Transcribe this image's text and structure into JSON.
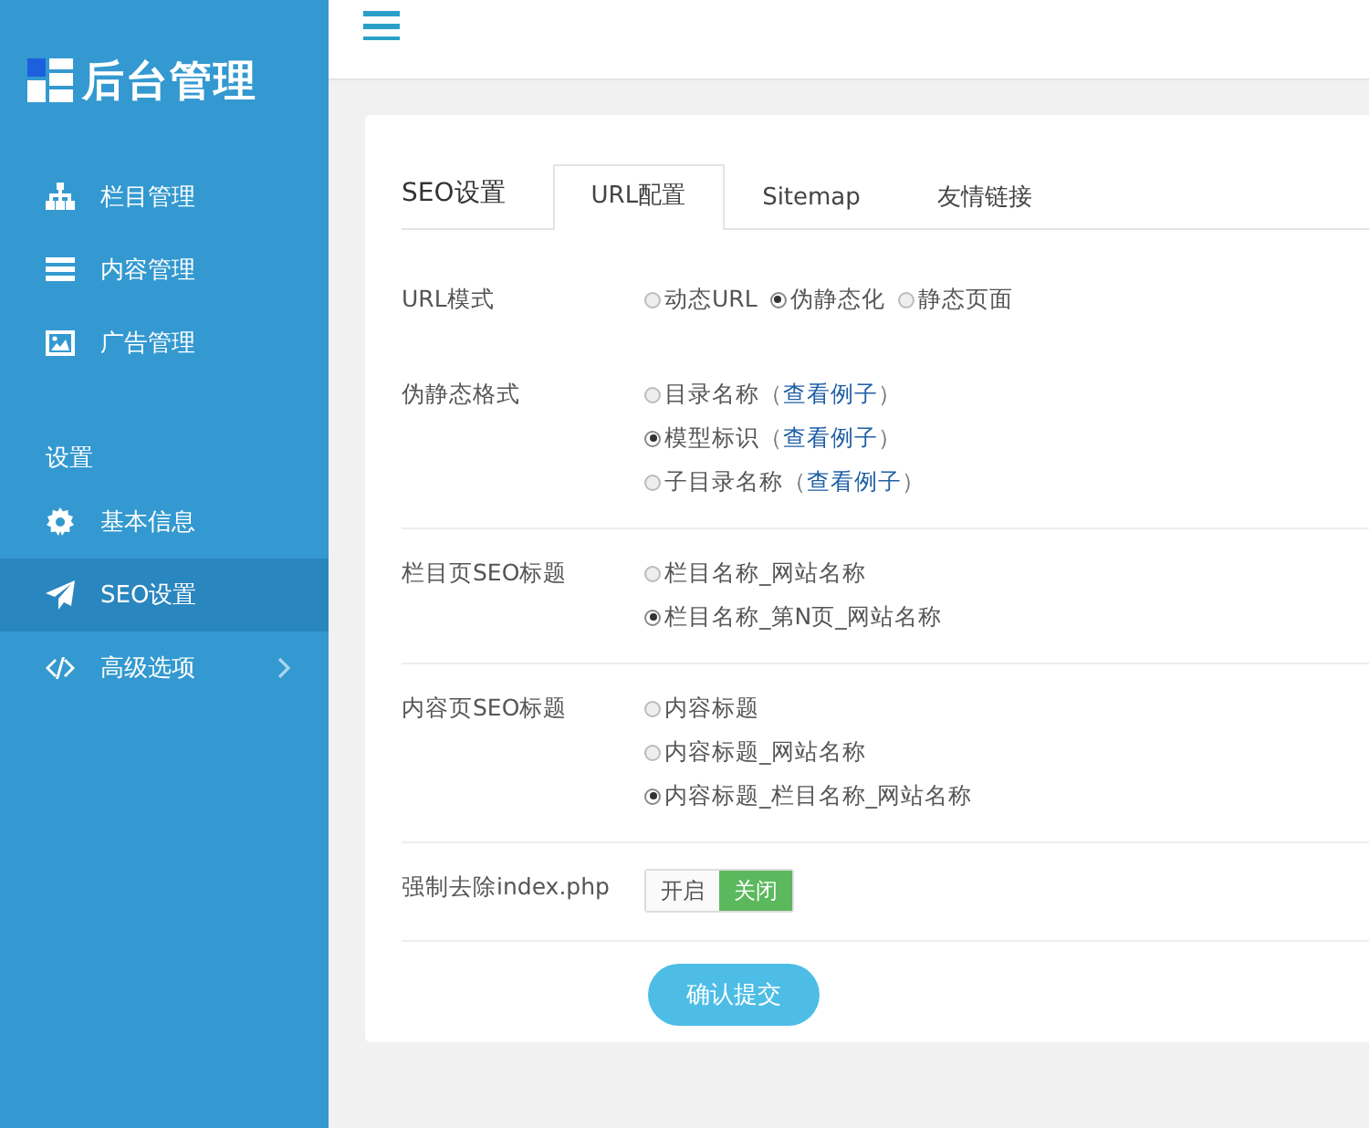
{
  "sidebar": {
    "logo": "后台管理",
    "items": [
      {
        "kind": "link",
        "label": "栏目管理",
        "selected": false
      },
      {
        "kind": "link",
        "label": "内容管理",
        "selected": false
      },
      {
        "kind": "link",
        "label": "广告管理",
        "selected": false
      },
      {
        "kind": "heading",
        "label": "设置"
      },
      {
        "kind": "link",
        "label": "基本信息",
        "selected": false
      },
      {
        "kind": "link",
        "label": "SEO设置",
        "selected": true
      },
      {
        "kind": "submenu",
        "label": "高级选项",
        "selected": false
      }
    ]
  },
  "panel": {
    "title": "SEO设置",
    "tabs": [
      {
        "label": "URL配置",
        "selected": true
      },
      {
        "label": "Sitemap",
        "selected": false
      },
      {
        "label": "友情链接",
        "selected": false
      }
    ],
    "fields": [
      {
        "kind": "inline-radio",
        "label": "URL模式",
        "options": [
          {
            "label": "动态URL",
            "selected": false
          },
          {
            "label": "伪静态化",
            "selected": true
          },
          {
            "label": "静态页面",
            "selected": false
          }
        ]
      },
      {
        "kind": "radio",
        "label": "伪静态格式",
        "options": [
          {
            "label": "目录名称",
            "link_open": "（",
            "link": "查看例子",
            "link_close": "）",
            "selected": false
          },
          {
            "label": "模型标识",
            "link_open": "（",
            "link": "查看例子",
            "link_close": "）",
            "selected": true
          },
          {
            "label": "子目录名称",
            "link_open": "（",
            "link": "查看例子",
            "link_close": "）",
            "selected": false
          }
        ]
      },
      {
        "kind": "radio",
        "label": "栏目页SEO标题",
        "options": [
          {
            "label": "栏目名称_网站名称",
            "selected": false
          },
          {
            "label": "栏目名称_第N页_网站名称",
            "selected": true
          }
        ]
      },
      {
        "kind": "radio",
        "label": "内容页SEO标题",
        "options": [
          {
            "label": "内容标题",
            "selected": false
          },
          {
            "label": "内容标题_网站名称",
            "selected": false
          },
          {
            "label": "内容标题_栏目名称_网站名称",
            "selected": true
          }
        ]
      },
      {
        "kind": "switch",
        "label": "强制去除index.php",
        "options": [
          {
            "label": "开启",
            "selected": false
          },
          {
            "label": "关闭",
            "selected": true
          }
        ]
      }
    ],
    "submit": "确认提交"
  }
}
